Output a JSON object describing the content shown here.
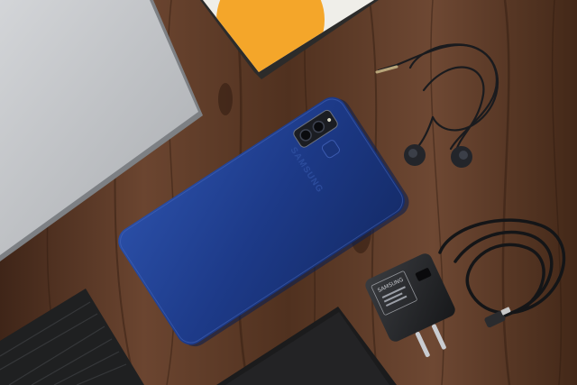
{
  "phone": {
    "brand": "SAMSUNG",
    "color": "#1e3d8f"
  },
  "charger": {
    "brand": "SAMSUNG"
  },
  "palette": {
    "table": "#5a3826",
    "laptop": "#b9bcc0",
    "book_accent": "#f4a62a"
  }
}
